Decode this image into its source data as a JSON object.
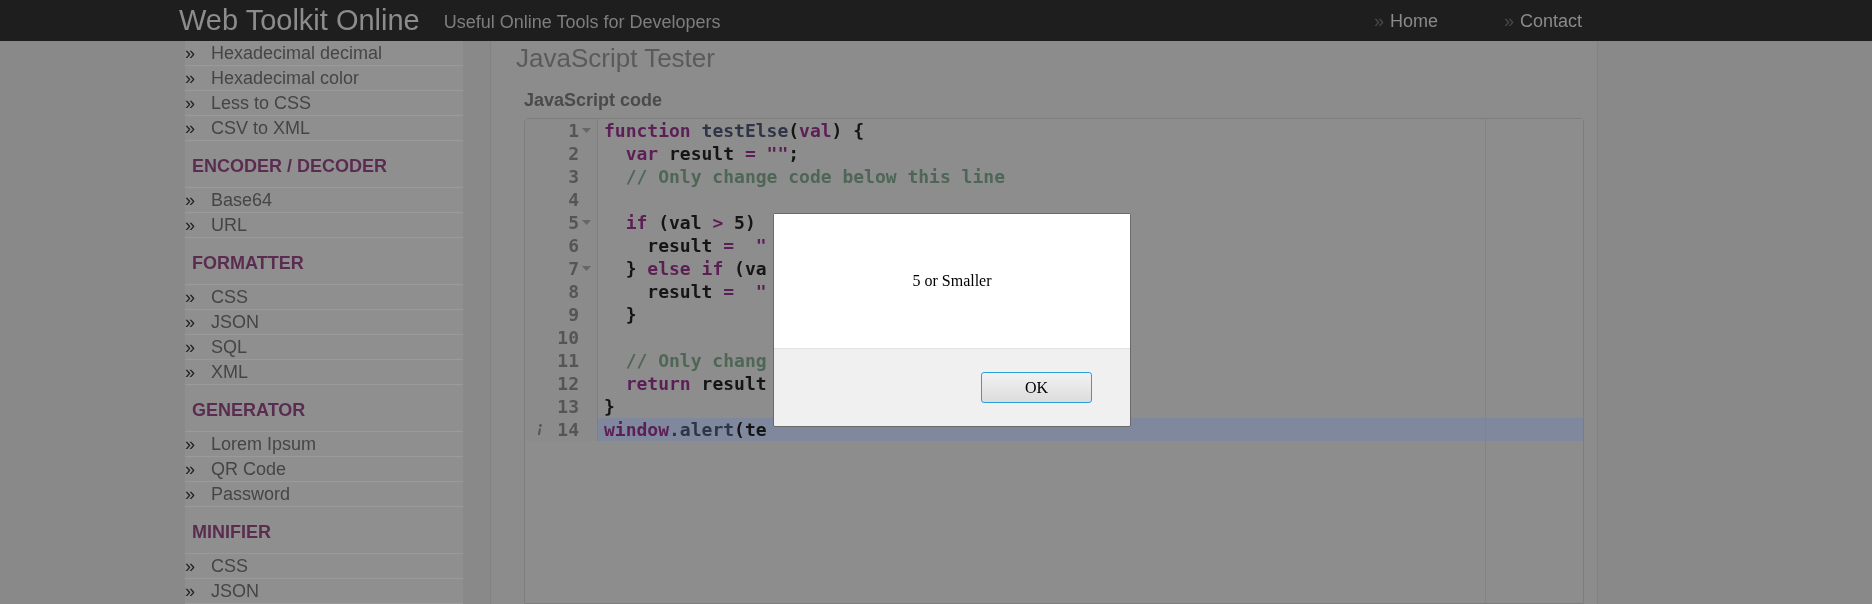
{
  "header": {
    "title": "Web Toolkit Online",
    "tagline": "Useful Online Tools for Developers",
    "nav": [
      {
        "marker": "»",
        "label": "Home"
      },
      {
        "marker": "»",
        "label": "Contact"
      }
    ]
  },
  "sidebar": {
    "sections": [
      {
        "items": [
          {
            "marker": "»",
            "label": "Hexadecimal decimal"
          },
          {
            "marker": "»",
            "label": "Hexadecimal color"
          },
          {
            "marker": "»",
            "label": "Less to CSS"
          },
          {
            "marker": "»",
            "label": "CSV to XML"
          }
        ]
      },
      {
        "heading": "ENCODER / DECODER",
        "items": [
          {
            "marker": "»",
            "label": "Base64"
          },
          {
            "marker": "»",
            "label": "URL"
          }
        ]
      },
      {
        "heading": "FORMATTER",
        "items": [
          {
            "marker": "»",
            "label": "CSS"
          },
          {
            "marker": "»",
            "label": "JSON"
          },
          {
            "marker": "»",
            "label": "SQL"
          },
          {
            "marker": "»",
            "label": "XML"
          }
        ]
      },
      {
        "heading": "GENERATOR",
        "items": [
          {
            "marker": "»",
            "label": "Lorem Ipsum"
          },
          {
            "marker": "»",
            "label": "QR Code"
          },
          {
            "marker": "»",
            "label": "Password"
          }
        ]
      },
      {
        "heading": "MINIFIER",
        "items": [
          {
            "marker": "»",
            "label": "CSS"
          },
          {
            "marker": "»",
            "label": "JSON"
          }
        ]
      }
    ]
  },
  "content": {
    "title": "JavaScript Tester",
    "editor_label": "JavaScript code",
    "code_lines": [
      {
        "number": "1",
        "fold": true,
        "info": false,
        "highlighted": false,
        "tokens": [
          {
            "kind": "keyword",
            "text": "function"
          },
          {
            "kind": "name",
            "text": " testElse"
          },
          {
            "kind": "plain",
            "text": "("
          },
          {
            "kind": "keyword",
            "text": "val"
          },
          {
            "kind": "plain",
            "text": ") {"
          }
        ]
      },
      {
        "number": "2",
        "fold": false,
        "info": false,
        "highlighted": false,
        "tokens": [
          {
            "kind": "keyword",
            "text": "  var"
          },
          {
            "kind": "plain",
            "text": " result "
          },
          {
            "kind": "keyword",
            "text": "= \"\""
          },
          {
            "kind": "plain",
            "text": ";"
          }
        ]
      },
      {
        "number": "3",
        "fold": false,
        "info": false,
        "highlighted": false,
        "tokens": [
          {
            "kind": "comment",
            "text": "  // Only change code below this line"
          }
        ]
      },
      {
        "number": "4",
        "fold": false,
        "info": false,
        "highlighted": false
      },
      {
        "number": "5",
        "fold": true,
        "info": false,
        "highlighted": false,
        "tokens": [
          {
            "kind": "keyword",
            "text": "  if"
          },
          {
            "kind": "plain",
            "text": " (val "
          },
          {
            "kind": "keyword",
            "text": ">"
          },
          {
            "kind": "plain",
            "text": " 5)"
          }
        ]
      },
      {
        "number": "6",
        "fold": false,
        "info": false,
        "highlighted": false,
        "tokens": [
          {
            "kind": "plain",
            "text": "    result "
          },
          {
            "kind": "keyword",
            "text": "=  \""
          }
        ]
      },
      {
        "number": "7",
        "fold": true,
        "info": false,
        "highlighted": false,
        "tokens": [
          {
            "kind": "plain",
            "text": "  } "
          },
          {
            "kind": "keyword",
            "text": "else if"
          },
          {
            "kind": "plain",
            "text": " (va"
          }
        ]
      },
      {
        "number": "8",
        "fold": false,
        "info": false,
        "highlighted": false,
        "tokens": [
          {
            "kind": "plain",
            "text": "    result "
          },
          {
            "kind": "keyword",
            "text": "=  \""
          }
        ]
      },
      {
        "number": "9",
        "fold": false,
        "info": false,
        "highlighted": false,
        "tokens": [
          {
            "kind": "plain",
            "text": "  }"
          }
        ]
      },
      {
        "number": "10",
        "fold": false,
        "info": false,
        "highlighted": false
      },
      {
        "number": "11",
        "fold": false,
        "info": false,
        "highlighted": false,
        "tokens": [
          {
            "kind": "comment",
            "text": "  // Only chang"
          }
        ]
      },
      {
        "number": "12",
        "fold": false,
        "info": false,
        "highlighted": false,
        "tokens": [
          {
            "kind": "keyword",
            "text": "  return"
          },
          {
            "kind": "plain",
            "text": " result"
          }
        ]
      },
      {
        "number": "13",
        "fold": false,
        "info": false,
        "highlighted": false,
        "tokens": [
          {
            "kind": "plain",
            "text": "}"
          }
        ]
      },
      {
        "number": "14",
        "fold": false,
        "info": true,
        "highlighted": true,
        "tokens": [
          {
            "kind": "keyword",
            "text": "window"
          },
          {
            "kind": "name",
            "text": ".alert"
          },
          {
            "kind": "plain",
            "text": "(te"
          }
        ]
      }
    ]
  },
  "dialog": {
    "message": "5 or Smaller",
    "button": "OK"
  }
}
